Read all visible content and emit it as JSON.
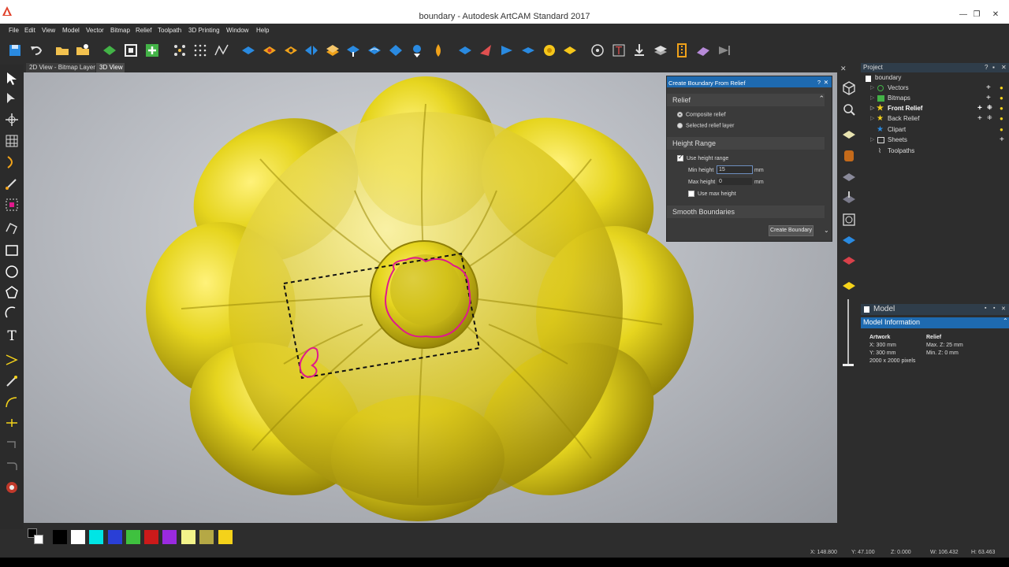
{
  "window": {
    "title": "boundary - Autodesk ArtCAM Standard 2017"
  },
  "menu": [
    "File",
    "Edit",
    "View",
    "Model",
    "Vector",
    "Bitmap",
    "Relief",
    "Toolpath",
    "3D Printing",
    "Window",
    "Help"
  ],
  "tabs": [
    "2D View - Bitmap Layer",
    "3D View"
  ],
  "create_boundary": {
    "title": "Create Boundary From Relief",
    "help": "?",
    "close": "✕",
    "relief_section": "Relief",
    "composite_label": "Composite relief",
    "selected_label": "Selected relief layer",
    "height_section": "Height Range",
    "use_height_label": "Use height range",
    "min_height_label": "Min height",
    "min_height_value": "15",
    "max_height_label": "Max height",
    "max_height_value": "0",
    "unit": "mm",
    "use_max_label": "Use max height",
    "smooth_section": "Smooth Boundaries",
    "button_label": "Create Boundary"
  },
  "project": {
    "title": "Project",
    "root": "boundary",
    "items": [
      {
        "label": "Vectors",
        "bold": false
      },
      {
        "label": "Bitmaps",
        "bold": false
      },
      {
        "label": "Front Relief",
        "bold": true
      },
      {
        "label": "Back Relief",
        "bold": false
      },
      {
        "label": "Clipart",
        "bold": false
      },
      {
        "label": "Sheets",
        "bold": false
      },
      {
        "label": "Toolpaths",
        "bold": false
      }
    ]
  },
  "model": {
    "title": "Model",
    "subtitle": "Model Information",
    "artwork_label": "Artwork",
    "artwork_x": "X: 300 mm",
    "artwork_y": "Y: 300 mm",
    "artwork_px": "2000 x 2000 pixels",
    "relief_label": "Relief",
    "relief_max": "Max. Z: 25 mm",
    "relief_min": "Min. Z: 0 mm"
  },
  "status": {
    "x": "X: 148.800",
    "y": "Y: 47.100",
    "z": "Z: 0.000",
    "w": "W: 106.432",
    "h": "H: 63.463"
  },
  "palette_colors": [
    "#000000",
    "#ffffff",
    "#00e5e5",
    "#2a3fd6",
    "#3fc13f",
    "#cc1a1a",
    "#9a2ae0",
    "#f3f38a",
    "#b5a845",
    "#f4d21a"
  ],
  "colors": {
    "accent": "#1e6ab0",
    "relief_gold": "#e2d21f",
    "boundary_magenta": "#e0198c"
  }
}
